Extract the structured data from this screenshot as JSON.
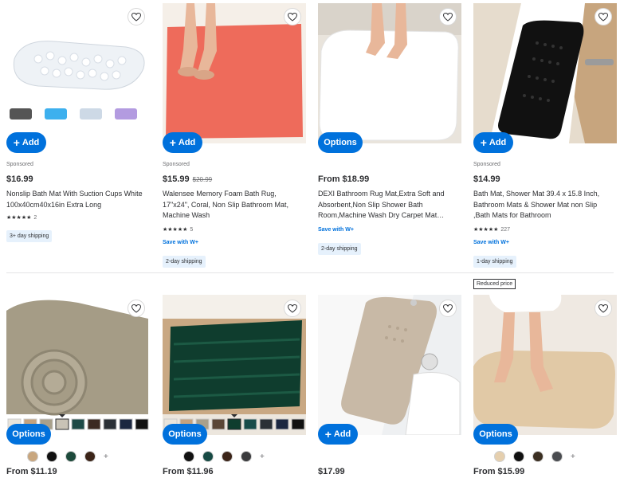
{
  "products_row1": [
    {
      "sponsored": "Sponsored",
      "button": "Add",
      "price": "$16.99",
      "old_price": "",
      "title": "Nonslip Bath Mat With Suction Cups White 100x40cm40x16in Extra Long",
      "stars": "★★★★★",
      "rating_count": "2",
      "save_with": "",
      "shipping": "3+ day shipping"
    },
    {
      "sponsored": "Sponsored",
      "button": "Add",
      "price": "$15.99",
      "old_price": "$20.99",
      "title": "Walensee Memory Foam Bath Rug, 17\"x24\", Coral, Non Slip Bathroom Mat, Machine Wash",
      "stars": "★★★★★",
      "rating_count": "5",
      "save_with": "Save with W+",
      "shipping": "2-day shipping"
    },
    {
      "sponsored": "",
      "button": "Options",
      "price": "From $18.99",
      "old_price": "",
      "title": "DEXI Bathroom Rug Mat,Extra Soft and Absorbent,Non Slip Shower Bath Room,Machine Wash Dry Carpet Mat…",
      "stars": "",
      "rating_count": "",
      "save_with": "Save with W+",
      "shipping": "2-day shipping"
    },
    {
      "sponsored": "Sponsored",
      "button": "Add",
      "price": "$14.99",
      "old_price": "",
      "title": "Bath Mat, Shower Mat 39.4 x 15.8 Inch, Bathroom Mats & Shower Mat non Slip ,Bath Mats for Bathroom",
      "stars": "★★★★★",
      "rating_count": "227",
      "save_with": "Save with W+",
      "shipping": "1-day shipping"
    }
  ],
  "products_row2": [
    {
      "button": "Options",
      "price": "From $11.19"
    },
    {
      "button": "Options",
      "price": "From $11.96"
    },
    {
      "button": "Add",
      "price": "$17.99"
    },
    {
      "button": "Options",
      "price": "From $15.99"
    }
  ],
  "badges": {
    "reduced_price": "Reduced price"
  },
  "more_colors_symbol": "+",
  "icons": {
    "favorite": "heart-icon",
    "add": "plus-icon"
  },
  "colors": {
    "accent": "#0071dc",
    "shipping_bg": "#e6f1fc",
    "divider": "#e3e4e5"
  }
}
